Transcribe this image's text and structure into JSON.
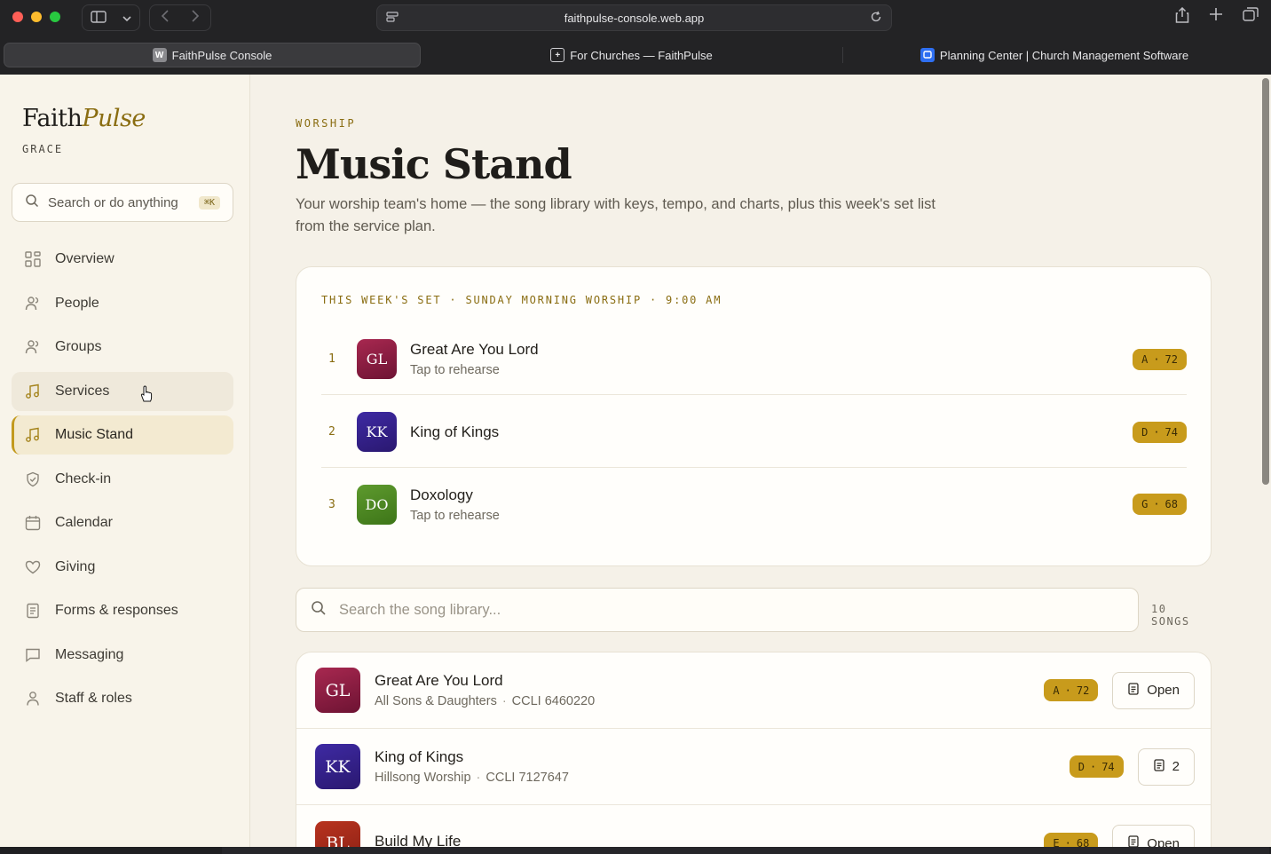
{
  "browser": {
    "url": "faithpulse-console.web.app",
    "tabs": [
      {
        "label": "FaithPulse Console",
        "favicon": "W"
      },
      {
        "label": "For Churches — FaithPulse",
        "favicon": "+"
      },
      {
        "label": "Planning Center | Church Management Software",
        "favicon": "P"
      }
    ]
  },
  "sidebar": {
    "brand_main": "Faith",
    "brand_accent": "Pulse",
    "org": "GRACE",
    "search_placeholder": "Search or do anything",
    "search_shortcut": "⌘K",
    "items": [
      {
        "label": "Overview",
        "icon": "grid-icon"
      },
      {
        "label": "People",
        "icon": "people-icon"
      },
      {
        "label": "Groups",
        "icon": "groups-icon"
      },
      {
        "label": "Services",
        "icon": "music-note-icon"
      },
      {
        "label": "Music Stand",
        "icon": "music-note-icon"
      },
      {
        "label": "Check-in",
        "icon": "shield-check-icon"
      },
      {
        "label": "Calendar",
        "icon": "calendar-icon"
      },
      {
        "label": "Giving",
        "icon": "heart-icon"
      },
      {
        "label": "Forms & responses",
        "icon": "form-icon"
      },
      {
        "label": "Messaging",
        "icon": "chat-icon"
      },
      {
        "label": "Staff & roles",
        "icon": "person-icon"
      }
    ]
  },
  "main": {
    "eyebrow": "WORSHIP",
    "title": "Music Stand",
    "description": "Your worship team's home — the song library with keys, tempo, and charts, plus this week's set list from the service plan.",
    "set": {
      "label": "THIS WEEK'S SET · SUNDAY MORNING WORSHIP · 9:00 AM",
      "songs": [
        {
          "num": "1",
          "initials": "GL",
          "name": "Great Are You Lord",
          "sub": "Tap to rehearse",
          "key": "A",
          "bpm": "72"
        },
        {
          "num": "2",
          "initials": "KK",
          "name": "King of Kings",
          "sub": "",
          "key": "D",
          "bpm": "74"
        },
        {
          "num": "3",
          "initials": "DO",
          "name": "Doxology",
          "sub": "Tap to rehearse",
          "key": "G",
          "bpm": "68"
        }
      ]
    },
    "library_search_placeholder": "Search the song library...",
    "songs_count": "10 SONGS",
    "library": [
      {
        "initials": "GL",
        "name": "Great Are You Lord",
        "artist": "All Sons & Daughters",
        "ccli": "CCLI 6460220",
        "key": "A",
        "bpm": "72",
        "action": "Open"
      },
      {
        "initials": "KK",
        "name": "King of Kings",
        "artist": "Hillsong Worship",
        "ccli": "CCLI 7127647",
        "key": "D",
        "bpm": "74",
        "action": "2"
      },
      {
        "initials": "BL",
        "name": "Build My Life",
        "artist": "",
        "ccli": "",
        "key": "E",
        "bpm": "68",
        "action": "Open"
      }
    ]
  },
  "colors": {
    "accent": "#c89b1c",
    "brand_accent": "#8a6d12"
  }
}
